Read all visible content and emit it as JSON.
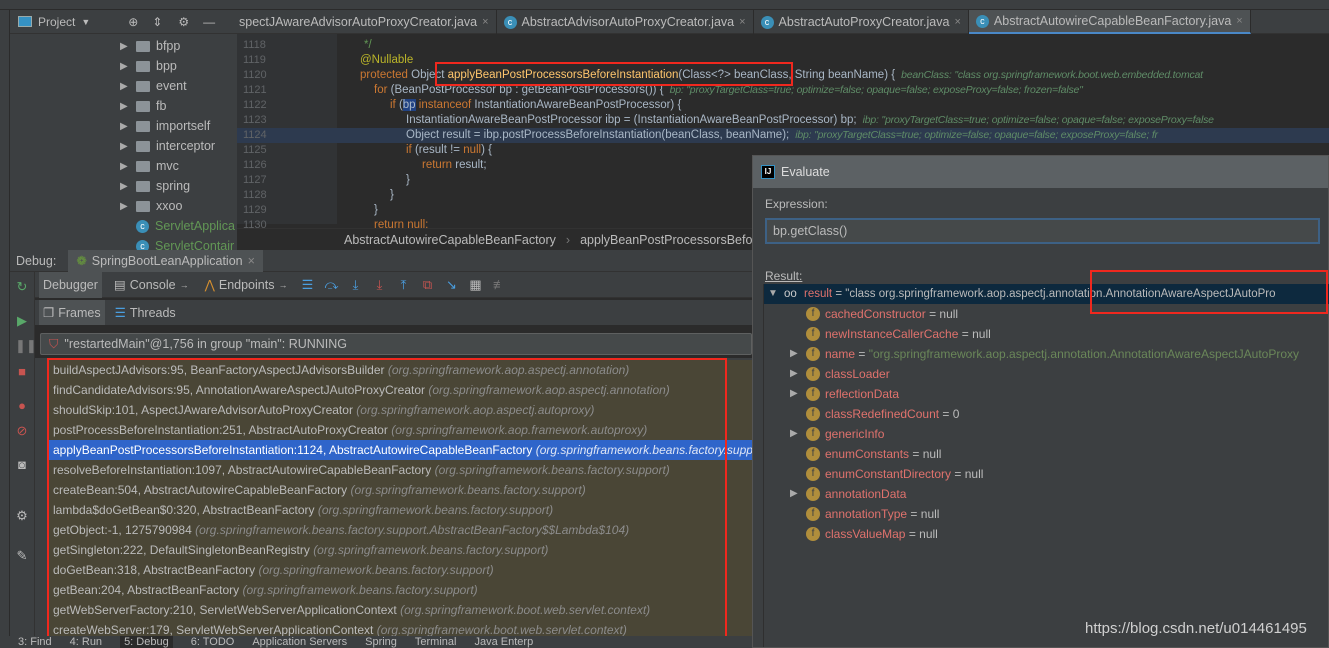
{
  "project": {
    "title": "Project",
    "items": [
      {
        "label": "bfpp",
        "type": "folder"
      },
      {
        "label": "bpp",
        "type": "folder"
      },
      {
        "label": "event",
        "type": "folder"
      },
      {
        "label": "fb",
        "type": "folder"
      },
      {
        "label": "importself",
        "type": "folder"
      },
      {
        "label": "interceptor",
        "type": "folder"
      },
      {
        "label": "mvc",
        "type": "folder"
      },
      {
        "label": "spring",
        "type": "folder"
      },
      {
        "label": "xxoo",
        "type": "folder"
      },
      {
        "label": "ServletApplica",
        "type": "class"
      },
      {
        "label": "ServletContair",
        "type": "class"
      }
    ]
  },
  "editor": {
    "tabs": [
      {
        "label": "spectJAwareAdvisorAutoProxyCreator.java",
        "active": false
      },
      {
        "label": "AbstractAdvisorAutoProxyCreator.java",
        "active": false
      },
      {
        "label": "AbstractAutoProxyCreator.java",
        "active": false
      },
      {
        "label": "AbstractAutowireCapableBeanFactory.java",
        "active": true
      }
    ],
    "lines": [
      {
        "n": "1118"
      },
      {
        "n": "1119"
      },
      {
        "n": "1120"
      },
      {
        "n": "1121"
      },
      {
        "n": "1122"
      },
      {
        "n": "1123"
      },
      {
        "n": "1124"
      },
      {
        "n": "1125"
      },
      {
        "n": "1126"
      },
      {
        "n": "1127"
      },
      {
        "n": "1128"
      },
      {
        "n": "1129"
      },
      {
        "n": "1130"
      }
    ],
    "code": {
      "c1118": "*/",
      "c1119": "@Nullable",
      "c1120_kw": "protected",
      "c1120_a": " Object ",
      "c1120_m": "applyBeanPostProcessorsBeforeInstantiation",
      "c1120_b": "(Class<?> beanClass, String beanName) {",
      "c1120_h": "beanClass: \"class org.springframework.boot.web.embedded.tomcat",
      "c1121_kw": "for",
      "c1121_a": " (BeanPostProcessor bp : getBeanPostProcessors()) {",
      "c1121_h": "bp: \"proxyTargetClass=true; optimize=false; opaque=false; exposeProxy=false; frozen=false\"",
      "c1122_kw": "if",
      "c1122_a": " (",
      "c1122_v": "bp",
      "c1122_kw2": " instanceof",
      "c1122_b": " InstantiationAwareBeanPostProcessor) {",
      "c1123": "InstantiationAwareBeanPostProcessor ibp = (InstantiationAwareBeanPostProcessor) bp;",
      "c1123_h": "ibp: \"proxyTargetClass=true; optimize=false; opaque=false; exposeProxy=false",
      "c1124": "Object result = ibp.postProcessBeforeInstantiation(beanClass, beanName);",
      "c1124_h": "ibp: \"proxyTargetClass=true; optimize=false; opaque=false; exposeProxy=false; fr",
      "c1125_kw": "if",
      "c1125_a": " (result != ",
      "c1125_kw2": "null",
      "c1125_b": ") {",
      "c1126_kw": "return",
      "c1126_a": " result;",
      "c1127": "}",
      "c1128": "}",
      "c1129": "}",
      "c1130_kw": "return null;"
    },
    "breadcrumb": [
      "AbstractAutowireCapableBeanFactory",
      "applyBeanPostProcessorsBefo"
    ]
  },
  "debug": {
    "label": "Debug:",
    "session": "SpringBootLeanApplication",
    "tabs": {
      "debugger": "Debugger",
      "console": "Console",
      "endpoints": "Endpoints"
    },
    "frames_tab": "Frames",
    "threads_tab": "Threads",
    "thread": "\"restartedMain\"@1,756 in group \"main\": RUNNING",
    "frames": [
      {
        "method": "buildAspectJAdvisors:95, BeanFactoryAspectJAdvisorsBuilder",
        "pkg": "(org.springframework.aop.aspectj.annotation)"
      },
      {
        "method": "findCandidateAdvisors:95, AnnotationAwareAspectJAutoProxyCreator",
        "pkg": "(org.springframework.aop.aspectj.annotation)"
      },
      {
        "method": "shouldSkip:101, AspectJAwareAdvisorAutoProxyCreator",
        "pkg": "(org.springframework.aop.aspectj.autoproxy)"
      },
      {
        "method": "postProcessBeforeInstantiation:251, AbstractAutoProxyCreator",
        "pkg": "(org.springframework.aop.framework.autoproxy)"
      },
      {
        "method": "applyBeanPostProcessorsBeforeInstantiation:1124, AbstractAutowireCapableBeanFactory",
        "pkg": "(org.springframework.beans.factory.support)",
        "selected": true
      },
      {
        "method": "resolveBeforeInstantiation:1097, AbstractAutowireCapableBeanFactory",
        "pkg": "(org.springframework.beans.factory.support)"
      },
      {
        "method": "createBean:504, AbstractAutowireCapableBeanFactory",
        "pkg": "(org.springframework.beans.factory.support)"
      },
      {
        "method": "lambda$doGetBean$0:320, AbstractBeanFactory",
        "pkg": "(org.springframework.beans.factory.support)"
      },
      {
        "method": "getObject:-1, 1275790984",
        "pkg": "(org.springframework.beans.factory.support.AbstractBeanFactory$$Lambda$104)"
      },
      {
        "method": "getSingleton:222, DefaultSingletonBeanRegistry",
        "pkg": "(org.springframework.beans.factory.support)"
      },
      {
        "method": "doGetBean:318, AbstractBeanFactory",
        "pkg": "(org.springframework.beans.factory.support)"
      },
      {
        "method": "getBean:204, AbstractBeanFactory",
        "pkg": "(org.springframework.beans.factory.support)"
      },
      {
        "method": "getWebServerFactory:210, ServletWebServerApplicationContext",
        "pkg": "(org.springframework.boot.web.servlet.context)"
      },
      {
        "method": "createWebServer:179, ServletWebServerApplicationContext",
        "pkg": "(org.springframework.boot.web.servlet.context)"
      }
    ]
  },
  "bottom_tabs": [
    "3: Find",
    "4: Run",
    "5: Debug",
    "6: TODO",
    "Application Servers",
    "Spring",
    "Terminal",
    "Java Enterp"
  ],
  "evaluate": {
    "title": "Evaluate",
    "expression_label": "Expression:",
    "expression": "bp.getClass()",
    "result_label": "Result:",
    "result": {
      "name": "result",
      "value": "= \"class org.springframework.aop.aspectj.annotation.AnnotationAwareAspectJAutoPro"
    },
    "fields": [
      {
        "name": "cachedConstructor",
        "value": "= null",
        "expandable": false
      },
      {
        "name": "newInstanceCallerCache",
        "value": "= null",
        "expandable": false
      },
      {
        "name": "name",
        "value": "= ",
        "str": "\"org.springframework.aop.aspectj.annotation.AnnotationAwareAspectJAutoProxy",
        "expandable": true
      },
      {
        "name": "classLoader",
        "value": "",
        "expandable": true
      },
      {
        "name": "reflectionData",
        "value": "",
        "expandable": true
      },
      {
        "name": "classRedefinedCount",
        "value": "= 0",
        "expandable": false
      },
      {
        "name": "genericInfo",
        "value": "",
        "expandable": true
      },
      {
        "name": "enumConstants",
        "value": "= null",
        "expandable": false
      },
      {
        "name": "enumConstantDirectory",
        "value": "= null",
        "expandable": false
      },
      {
        "name": "annotationData",
        "value": "",
        "expandable": true
      },
      {
        "name": "annotationType",
        "value": "= null",
        "expandable": false
      },
      {
        "name": "classValueMap",
        "value": "= null",
        "expandable": false
      }
    ]
  },
  "watermark": "https://blog.csdn.net/u014461495",
  "colors": {
    "highlight_box": "#f0281e",
    "selection": "#2f65ca",
    "keyword": "#cc7832",
    "method": "#ffc66d",
    "field": "#e0726d"
  }
}
